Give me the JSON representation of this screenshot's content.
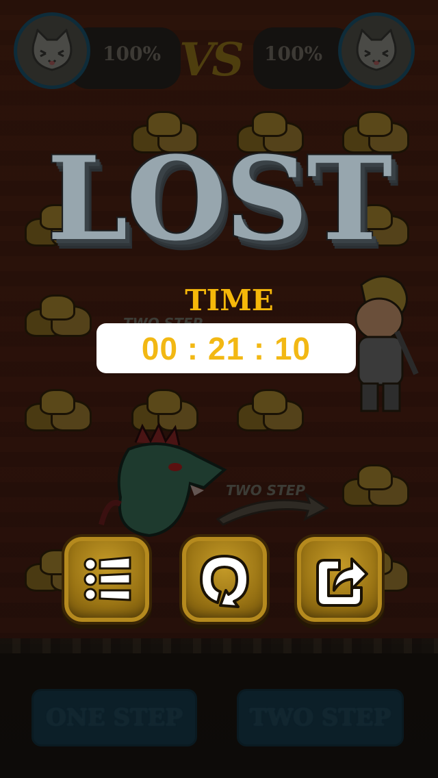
{
  "hud": {
    "left_percent": "100%",
    "right_percent": "100%",
    "vs_label": "VS"
  },
  "result": {
    "title": "LOST",
    "time_label": "TIME",
    "time_value": "00 : 21 : 10"
  },
  "board_labels": {
    "ghost_step_1": "TWO STEP",
    "ghost_step_2": "TWO STEP"
  },
  "actions": [
    {
      "name": "menu",
      "icon": "list-menu-icon"
    },
    {
      "name": "restart",
      "icon": "restart-icon"
    },
    {
      "name": "share",
      "icon": "share-icon"
    }
  ],
  "controls": {
    "one_step_label": "ONE STEP",
    "two_step_label": "TWO STEP"
  },
  "colors": {
    "time_gold": "#f6b80a",
    "lost_gray": "#97a6ae",
    "button_gold": "#b58a1e"
  }
}
